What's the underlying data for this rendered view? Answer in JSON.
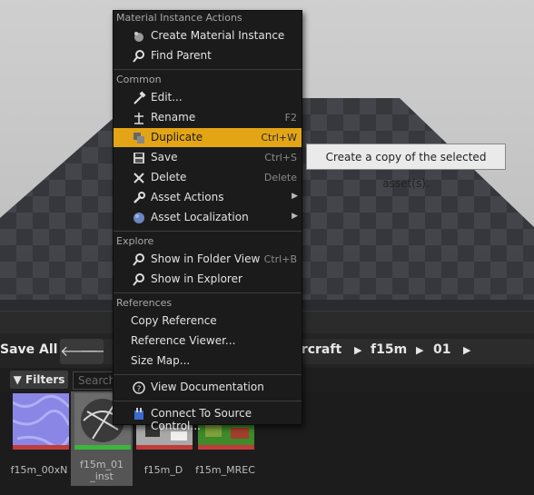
{
  "menu": {
    "sections": {
      "material": "Material Instance Actions",
      "common": "Common",
      "explore": "Explore",
      "references": "References"
    },
    "items": {
      "create_mi": "Create Material Instance",
      "find_parent": "Find Parent",
      "edit": "Edit...",
      "rename": "Rename",
      "rename_sc": "F2",
      "duplicate": "Duplicate",
      "duplicate_sc": "Ctrl+W",
      "save": "Save",
      "save_sc": "Ctrl+S",
      "delete": "Delete",
      "delete_sc": "Delete",
      "asset_actions": "Asset Actions",
      "asset_localization": "Asset Localization",
      "show_folder": "Show in Folder View",
      "show_folder_sc": "Ctrl+B",
      "show_explorer": "Show in Explorer",
      "copy_ref": "Copy Reference",
      "ref_viewer": "Reference Viewer...",
      "size_map": "Size Map...",
      "view_docs": "View Documentation",
      "connect_sc": "Connect To Source Control..."
    },
    "highlight_color": "#e3a516"
  },
  "tooltip": "Create a copy of the selected asset(s).",
  "toolbar": {
    "save_all": "Save All",
    "crumbs": [
      "ircraft",
      "f15m",
      "01"
    ]
  },
  "filters": {
    "label": "Filters",
    "search_placeholder": "Search"
  },
  "assets": [
    {
      "label": "f15m_00xN"
    },
    {
      "label": "f15m_01_inst",
      "selected": true
    },
    {
      "label": "f15m_D"
    },
    {
      "label": "f15m_MREC"
    }
  ]
}
